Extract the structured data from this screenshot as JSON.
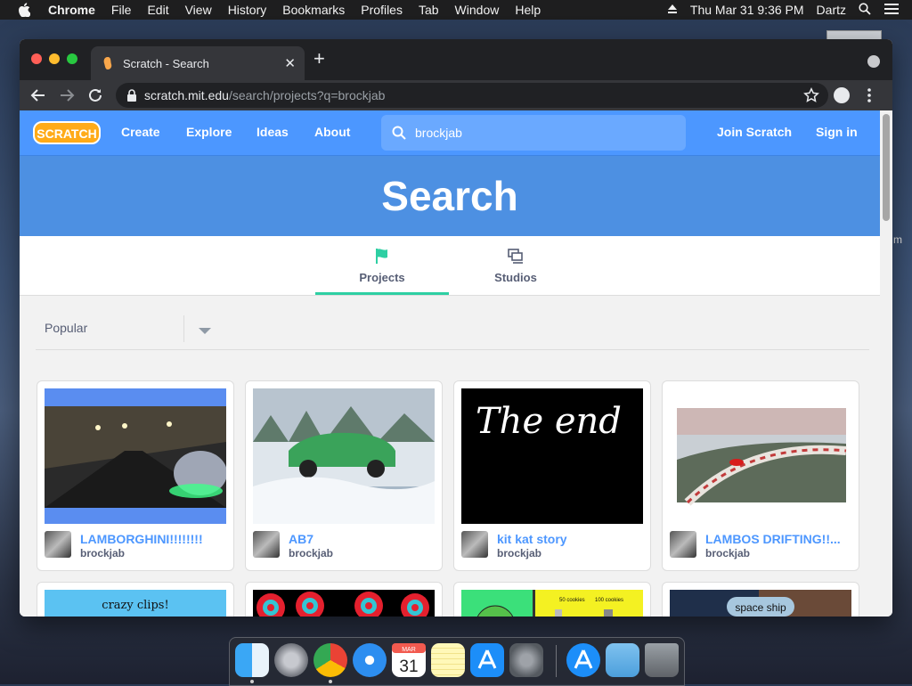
{
  "menubar": {
    "items": [
      "Chrome",
      "File",
      "Edit",
      "View",
      "History",
      "Bookmarks",
      "Profiles",
      "Tab",
      "Window",
      "Help"
    ],
    "datetime": "Thu Mar 31  9:36 PM",
    "user": "Dartz"
  },
  "desktop": {
    "side_label": "m"
  },
  "browser": {
    "tab_title": "Scratch - Search",
    "url_host": "scratch.mit.edu",
    "url_path": "/search/projects?q=brockjab"
  },
  "scratch": {
    "nav": {
      "create": "Create",
      "explore": "Explore",
      "ideas": "Ideas",
      "about": "About",
      "join": "Join Scratch",
      "signin": "Sign in"
    },
    "search_value": "brockjab",
    "banner_title": "Search",
    "tabs": [
      {
        "label": "Projects",
        "active": true
      },
      {
        "label": "Studios",
        "active": false
      }
    ],
    "sort": "Popular",
    "projects": [
      {
        "title": "LAMBORGHINI!!!!!!!!",
        "author": "brockjab"
      },
      {
        "title": "AB7",
        "author": "brockjab"
      },
      {
        "title": "kit kat story",
        "author": "brockjab",
        "thumb_text": "The end"
      },
      {
        "title": "LAMBOS DRIFTING!!...",
        "author": "brockjab"
      }
    ],
    "row2": [
      {
        "thumb_text": "crazy clips!"
      },
      {
        "thumb_text": ""
      },
      {
        "thumb_text_1": "50 cookies",
        "thumb_text_2": "100 cookies"
      },
      {
        "thumb_text": "space ship"
      }
    ]
  },
  "dock": {
    "apps": [
      "finder-icon",
      "launchpad-icon",
      "chrome-icon",
      "safari-icon",
      "calendar-icon",
      "notes-icon",
      "app-store-icon",
      "system-preferences-icon",
      "downloads-app-store-icon",
      "downloads-folder-icon",
      "trash-icon"
    ],
    "calendar_month": "MAR",
    "calendar_day": "31"
  }
}
